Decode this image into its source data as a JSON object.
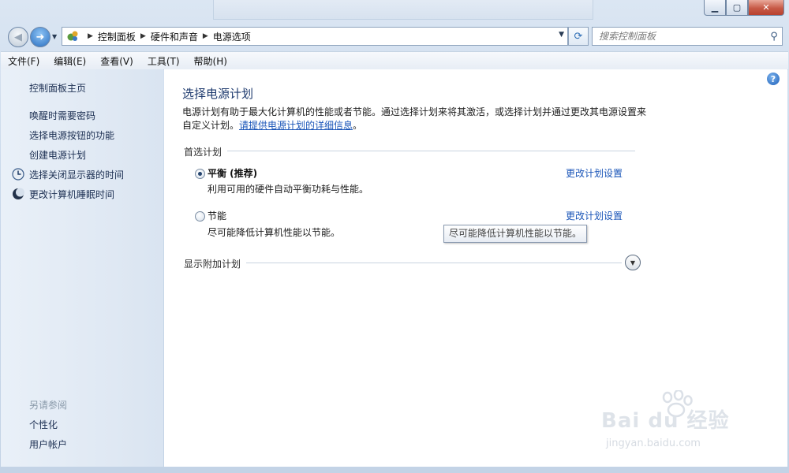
{
  "window": {
    "min_label": "▁",
    "max_label": "▢",
    "close_label": "✕"
  },
  "nav": {
    "back_glyph": "◀",
    "forward_glyph": "➜",
    "breadcrumb": [
      "控制面板",
      "硬件和声音",
      "电源选项"
    ],
    "search_placeholder": "搜索控制面板"
  },
  "menu": [
    "文件(F)",
    "编辑(E)",
    "查看(V)",
    "工具(T)",
    "帮助(H)"
  ],
  "sidebar": {
    "home": "控制面板主页",
    "items": [
      {
        "label": "唤醒时需要密码",
        "icon": ""
      },
      {
        "label": "选择电源按钮的功能",
        "icon": ""
      },
      {
        "label": "创建电源计划",
        "icon": ""
      },
      {
        "label": "选择关闭显示器的时间",
        "icon": "monitor-clock-icon"
      },
      {
        "label": "更改计算机睡眠时间",
        "icon": "moon-icon"
      }
    ],
    "see_also_title": "另请参阅",
    "see_also": [
      "个性化",
      "用户帐户"
    ]
  },
  "content": {
    "title": "选择电源计划",
    "description": "电源计划有助于最大化计算机的性能或者节能。通过选择计划来将其激活，或选择计划并通过更改其电源设置来自定义计划。",
    "description_link": "请提供电源计划的详细信息",
    "description_end": "。",
    "preferred_label": "首选计划",
    "plans": [
      {
        "name": "平衡 (推荐)",
        "description": "利用可用的硬件自动平衡功耗与性能。",
        "selected": true,
        "change_label": "更改计划设置"
      },
      {
        "name": "节能",
        "description": "尽可能降低计算机性能以节能。",
        "selected": false,
        "change_label": "更改计划设置"
      }
    ],
    "tooltip": "尽可能降低计算机性能以节能。",
    "additional_label": "显示附加计划"
  },
  "watermark": {
    "brand": "Bai du 经验",
    "url": "jingyan.baidu.com"
  }
}
